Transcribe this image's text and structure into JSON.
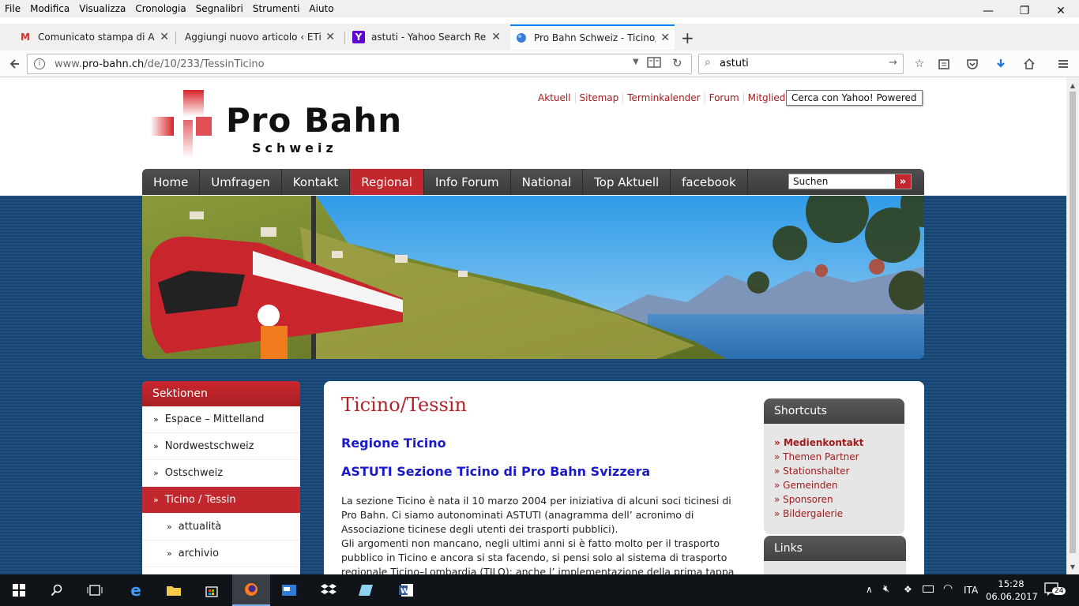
{
  "browser": {
    "menu": [
      "File",
      "Modifica",
      "Visualizza",
      "Cronologia",
      "Segnalibri",
      "Strumenti",
      "Aiuto"
    ],
    "tabs": [
      {
        "title": "Comunicato stampa di ASTUTI",
        "icon": "gmail-icon"
      },
      {
        "title": "Aggiungi nuovo articolo ‹ ETiCinfo",
        "icon": "wordpress-icon"
      },
      {
        "title": "astuti - Yahoo Search Results",
        "icon": "yahoo-icon"
      },
      {
        "title": "Pro Bahn Schweiz - Ticino/Tessin",
        "icon": "probahn-icon"
      }
    ],
    "url_prefix": "www.",
    "url_domain": "pro-bahn.ch",
    "url_path": "/de/10/233/TessinTicino",
    "search_value": "astuti",
    "tooltip": "Cerca con Yahoo! Powered"
  },
  "site": {
    "logo_line1": "Pro Bahn",
    "logo_line2": "Schweiz",
    "toplinks": [
      "Aktuell",
      "Sitemap",
      "Terminkalender",
      "Forum",
      "Mitglied"
    ],
    "nav": [
      "Home",
      "Umfragen",
      "Kontakt",
      "Regional",
      "Info Forum",
      "National",
      "Top Aktuell",
      "facebook"
    ],
    "nav_selected": "Regional",
    "search_value": "Suchen",
    "search_go": "»"
  },
  "sidebar": {
    "heading": "Sektionen",
    "items": [
      {
        "label": "Espace – Mittelland"
      },
      {
        "label": "Nordwestschweiz"
      },
      {
        "label": "Ostschweiz"
      },
      {
        "label": "Ticino / Tessin"
      },
      {
        "label": "attualità"
      },
      {
        "label": "archivio"
      }
    ],
    "chevron": "»"
  },
  "content": {
    "title": "Ticino/Tessin",
    "subtitle1": "Regione Ticino",
    "subtitle2": "ASTUTI Sezione Ticino di Pro Bahn Svizzera",
    "paragraph1": "La sezione Ticino è nata il 10 marzo 2004 per iniziativa di alcuni soci ticinesi di Pro Bahn. Ci siamo autonominati ASTUTI (anagramma dell’ acronimo di Associazione ticinese degli utenti dei trasporti pubblici).",
    "paragraph2": "Gli argomenti non mancano, negli ultimi anni si è fatto molto per il trasporto pubblico in Ticino e ancora si sta facendo, si pensi solo al sistema di trasporto regionale Ticino–Lombardia (TILO); anche l’ implementazione della prima tappa"
  },
  "shortcuts": {
    "heading": "Shortcuts",
    "items": [
      {
        "label": "Medienkontakt"
      },
      {
        "label": "Themen Partner"
      },
      {
        "label": "Stationshalter"
      },
      {
        "label": "Gemeinden"
      },
      {
        "label": "Sponsoren"
      },
      {
        "label": "Bildergalerie"
      }
    ],
    "marker": "»"
  },
  "links_box": {
    "heading": "Links"
  },
  "taskbar": {
    "lang": "ITA",
    "time": "15:28",
    "date": "06.06.2017",
    "notifications": "24"
  },
  "colors": {
    "accent": "#c1272d",
    "link": "#a01c1c",
    "heading_blue": "#1a1ac8",
    "page_bg": "#1e4f7e"
  }
}
